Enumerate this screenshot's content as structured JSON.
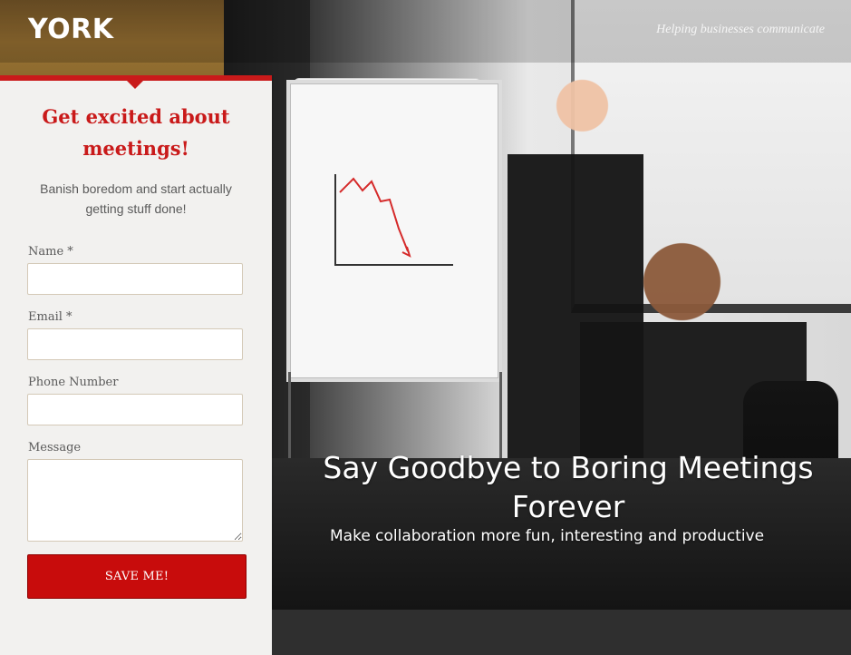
{
  "header": {
    "logo_text": "YORK",
    "tagline": "Helping businesses communicate"
  },
  "form_panel": {
    "title": "Get excited about meetings!",
    "subtitle": "Banish boredom and start actually getting stuff done!",
    "fields": [
      {
        "label": "Name *",
        "value": "",
        "placeholder": ""
      },
      {
        "label": "Email *",
        "value": "",
        "placeholder": ""
      },
      {
        "label": "Phone Number",
        "value": "",
        "placeholder": ""
      },
      {
        "label": "Message",
        "value": "",
        "placeholder": ""
      }
    ],
    "submit_label": "SAVE ME!"
  },
  "hero": {
    "title": "Say Goodbye to Boring Meetings Forever",
    "subtitle": "Make collaboration more fun, interesting and productive"
  },
  "colors": {
    "accent_red": "#c91a1a",
    "panel_bg": "#f2f1ef"
  }
}
